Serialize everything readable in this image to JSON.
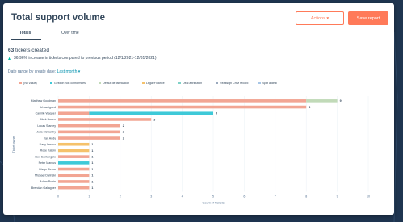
{
  "header": {
    "title": "Total support volume",
    "actions_label": "Actions ▾",
    "save_label": "Save report"
  },
  "tabs": [
    {
      "label": "Totals",
      "active": true
    },
    {
      "label": "Over time",
      "active": false
    }
  ],
  "summary": {
    "count": "63",
    "count_suffix": "tickets created",
    "increase_text": "36.96% increase in tickets compared to previous period (12/1/2021-12/31/2021)"
  },
  "filter": {
    "label": "Date range by create date:",
    "value": "Last month ▾"
  },
  "colors": {
    "accent": "#ff7a59",
    "series": [
      "#f2a593",
      "#3ec9d8",
      "#c1dab8",
      "#f5c26b",
      "#7fd1c7",
      "#9aa9bd",
      "#a7c6e6"
    ]
  },
  "chart_data": {
    "type": "bar",
    "orientation": "horizontal",
    "stacked": true,
    "legend_position": "top",
    "legend": [
      "(No value)",
      "Gestion non conformités",
      "Défaut de fabrication",
      "Legal/Finance",
      "Deal attribution",
      "Reassign CRM record",
      "Split a deal"
    ],
    "categories": [
      "Matthew Goodman",
      "Unassigned",
      "Camille Wagner",
      "Mark Boden",
      "Lucas Stanley",
      "Julia McCarthy",
      "Yan Andy",
      "Dany Leroux",
      "Rose Kaloin",
      "Alex Santangelo",
      "Peter Marcus",
      "Diego Pirzon",
      "Michael Dalinski",
      "Adam Rubin",
      "Brendan Gallagher"
    ],
    "series": [
      {
        "name": "(No value)",
        "values": [
          8,
          8,
          1,
          3,
          2,
          2,
          2,
          0,
          0,
          1,
          0,
          1,
          1,
          1,
          1
        ]
      },
      {
        "name": "Gestion non conformités",
        "values": [
          0,
          0,
          4,
          0,
          0,
          0,
          0,
          0,
          0,
          0,
          1,
          0,
          0,
          0,
          0
        ]
      },
      {
        "name": "Défaut de fabrication",
        "values": [
          1,
          0,
          0,
          0,
          0,
          0,
          0,
          0,
          0,
          0,
          0,
          0,
          0,
          0,
          0
        ]
      },
      {
        "name": "Legal/Finance",
        "values": [
          0,
          0,
          0,
          0,
          0,
          0,
          0,
          1,
          1,
          0,
          0,
          0,
          0,
          0,
          0
        ]
      },
      {
        "name": "Deal attribution",
        "values": [
          0,
          0,
          0,
          0,
          0,
          0,
          0,
          0,
          0,
          0,
          0,
          0,
          0,
          0,
          0
        ]
      },
      {
        "name": "Reassign CRM record",
        "values": [
          0,
          0,
          0,
          0,
          0,
          0,
          0,
          0,
          0,
          0,
          0,
          0,
          0,
          0,
          0
        ]
      },
      {
        "name": "Split a deal",
        "values": [
          0,
          0,
          0,
          0,
          0,
          0,
          0,
          0,
          0,
          0,
          0,
          0,
          0,
          0,
          0
        ]
      }
    ],
    "totals": [
      9,
      8,
      5,
      3,
      2,
      2,
      2,
      1,
      1,
      1,
      1,
      1,
      1,
      1,
      1
    ],
    "xlabel": "Count of Tickets",
    "ylabel": "Ticket owner",
    "xlim": [
      0,
      10
    ],
    "xticks": [
      0,
      1,
      2,
      3,
      4,
      5,
      6,
      7,
      8,
      9,
      10
    ],
    "grid": true
  }
}
